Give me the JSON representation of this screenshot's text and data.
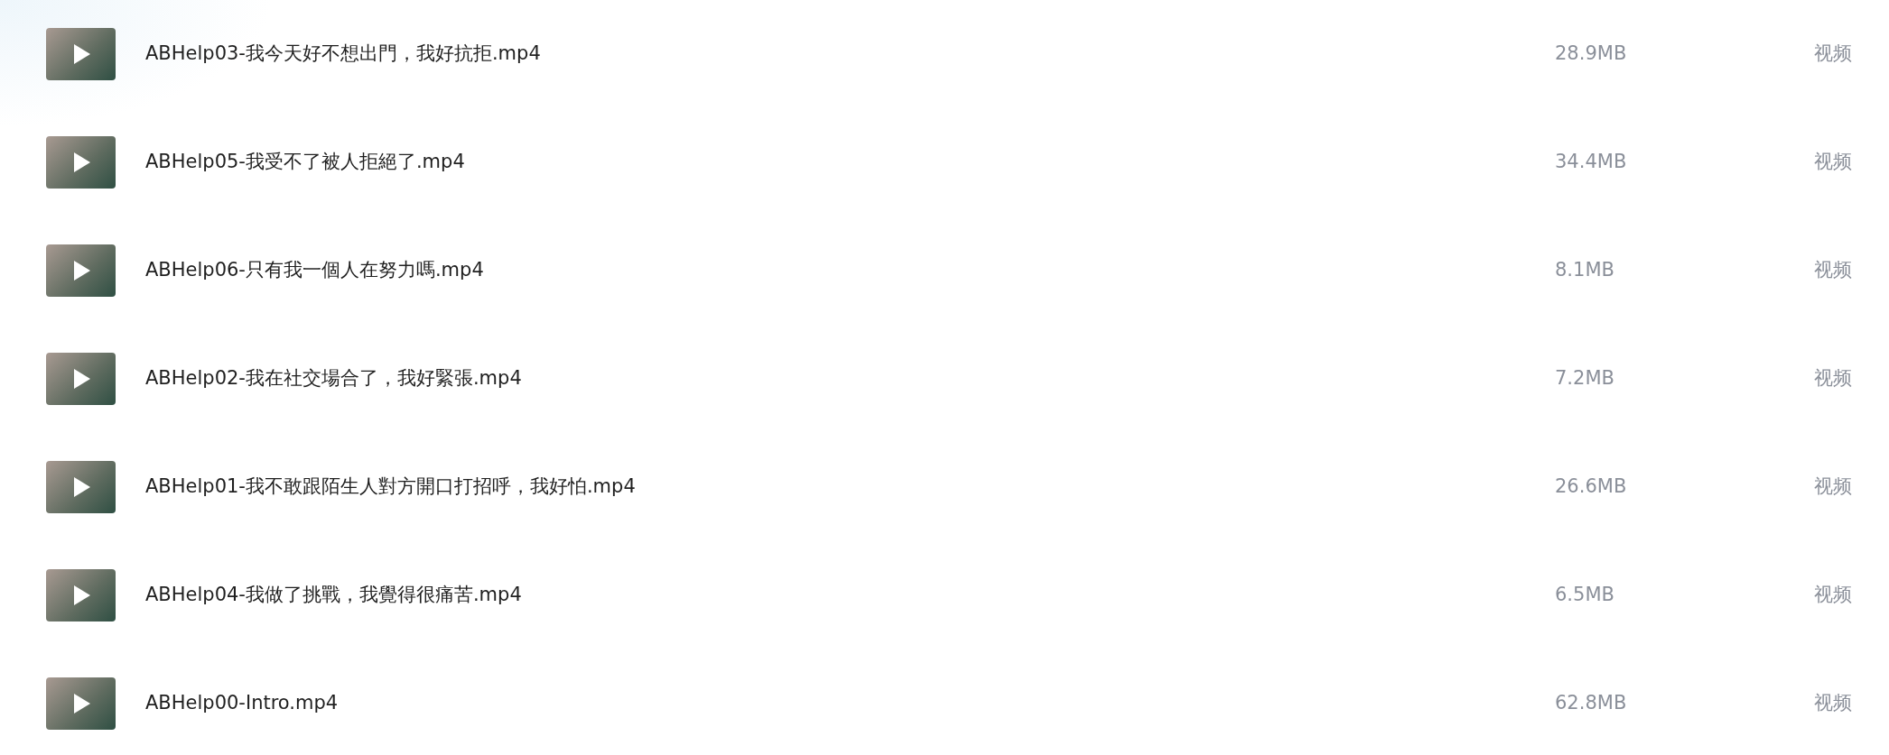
{
  "files": [
    {
      "name": "ABHelp03-我今天好不想出門，我好抗拒.mp4",
      "size": "28.9MB",
      "type": "视频"
    },
    {
      "name": "ABHelp05-我受不了被人拒絕了.mp4",
      "size": "34.4MB",
      "type": "视频"
    },
    {
      "name": "ABHelp06-只有我一個人在努力嗎.mp4",
      "size": "8.1MB",
      "type": "视频"
    },
    {
      "name": "ABHelp02-我在社交場合了，我好緊張.mp4",
      "size": "7.2MB",
      "type": "视频"
    },
    {
      "name": "ABHelp01-我不敢跟陌生人對方開口打招呼，我好怕.mp4",
      "size": "26.6MB",
      "type": "视频"
    },
    {
      "name": "ABHelp04-我做了挑戰，我覺得很痛苦.mp4",
      "size": "6.5MB",
      "type": "视频"
    },
    {
      "name": "ABHelp00-Intro.mp4",
      "size": "62.8MB",
      "type": "视频"
    }
  ]
}
